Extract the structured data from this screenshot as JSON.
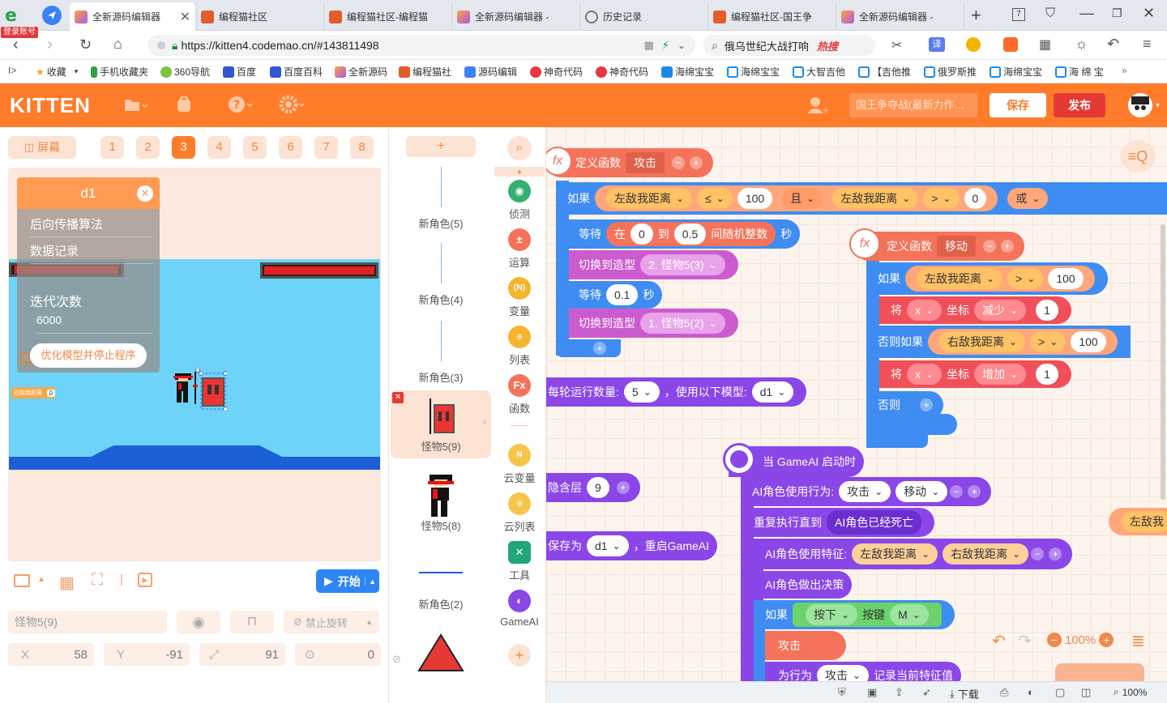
{
  "browser": {
    "login_badge": "登录账号",
    "tabs": [
      {
        "label": "全新源码编辑器",
        "active": true
      },
      {
        "label": "编程猫社区"
      },
      {
        "label": "编程猫社区-编程猫"
      },
      {
        "label": "全新源码编辑器 -"
      },
      {
        "label": "历史记录"
      },
      {
        "label": "编程猫社区-国王争"
      },
      {
        "label": "全新源码编辑器 -"
      }
    ],
    "url": "https://kitten4.codemao.cn/#143811498",
    "search_text": "俄乌世纪大战打响",
    "search_hot": "热搜",
    "translate_label": "译",
    "bookmarks": [
      "收藏",
      "手机收藏夹",
      "360导航",
      "百度",
      "百度百科",
      "全新源码",
      "编程猫社",
      "源码编辑",
      "神奇代码",
      "神奇代码",
      "海绵宝宝",
      "海绵宝宝",
      "大智吉他",
      "【吉他推",
      "俄罗斯推",
      "海绵宝宝",
      "海 绵 宝"
    ]
  },
  "kitten": {
    "logo": "KITTEN",
    "project_name": "国王争夺战(最新力作…",
    "save": "保存",
    "publish": "发布",
    "screen_btn": "屏幕",
    "scenes": [
      "1",
      "2",
      "3",
      "4",
      "5",
      "6",
      "7",
      "8"
    ],
    "active_scene": "3"
  },
  "stage": {
    "panel_title": "d1",
    "panel_items": [
      "后向传播算法",
      "数据记录"
    ],
    "iteration_label": "迭代次数",
    "iteration_value": "6000",
    "optimize_btn": "优化模型并停止程序",
    "small_label1": "左敌",
    "small_label2": "右敌我距离",
    "small_value2": "0",
    "start_btn": "开始"
  },
  "props": {
    "sprite_name": "怪物5(9)",
    "no_rotate": "禁止旋转",
    "x_label": "X",
    "x": "58",
    "y_label": "Y",
    "y": "-91",
    "size": "91",
    "dir": "0"
  },
  "sprites": [
    "新角色(5)",
    "新角色(4)",
    "新角色(3)",
    "怪物5(9)",
    "怪物5(8)",
    "新角色(2)"
  ],
  "categories": [
    "侦测",
    "运算",
    "变量",
    "列表",
    "函数",
    "云变量",
    "云列表",
    "工具",
    "GameAI"
  ],
  "blocks": {
    "def1": {
      "label": "定义函数",
      "name": "攻击"
    },
    "if1": {
      "if": "如果",
      "a": "左敌我距离",
      "op1": "≤",
      "v1": "100",
      "and": "且",
      "b": "左敌我距离",
      "op2": ">",
      "v2": "0",
      "or": "或"
    },
    "wait1": {
      "wait": "等待",
      "in": "在",
      "from": "0",
      "to": "到",
      "to_v": "0.5",
      "rand": "间随机整数",
      "sec": "秒"
    },
    "switch1": {
      "label": "切换到造型",
      "idx": "2.",
      "costume": "怪物5(3)"
    },
    "wait2": {
      "wait": "等待",
      "val": "0.1",
      "sec": "秒"
    },
    "switch2": {
      "label": "切换到造型",
      "idx": "1.",
      "costume": "怪物5(2)"
    },
    "perround": {
      "label": "每轮运行数量:",
      "val": "5",
      "mid": "，使用以下模型:",
      "model": "d1"
    },
    "hidden": {
      "label": "隐含层",
      "val": "9"
    },
    "saveas": {
      "label": "保存为",
      "model": "d1",
      "rest": "，重启GameAI"
    },
    "def2": {
      "label": "定义函数",
      "name": "移动"
    },
    "if2": {
      "if": "如果",
      "a": "左敌我距离",
      "op": ">",
      "v": "100"
    },
    "move1": {
      "set": "将",
      "axis": "x",
      "coord": "坐标",
      "dir": "减少",
      "v": "1"
    },
    "elif": {
      "label": "否则如果",
      "a": "右敌我距离",
      "op": ">",
      "v": "100"
    },
    "move2": {
      "set": "将",
      "axis": "x",
      "coord": "坐标",
      "dir": "增加",
      "v": "1"
    },
    "else": "否则",
    "gameai_start": "当 GameAI 启动时",
    "ai_behav": {
      "label": "AI角色使用行为:",
      "a": "攻击",
      "b": "移动"
    },
    "repeat": {
      "label": "重复执行直到",
      "cond": "AI角色已经死亡"
    },
    "feature": {
      "label": "AI角色使用特征:",
      "a": "左敌我距离",
      "b": "右敌我距离"
    },
    "decide": "AI角色做出决策",
    "if3": {
      "if": "如果",
      "press": "按下",
      "key": "按键",
      "k": "M"
    },
    "attack": "攻击",
    "record": {
      "pre": "为行为",
      "a": "攻击",
      "rest": "记录当前特征值"
    },
    "edge_pill": "左敌我"
  },
  "zoom": "100%",
  "status": {
    "download": "下载",
    "zoom": "100%"
  },
  "colors": {
    "orange": "#ff7c2b",
    "purple": "#8b46e8",
    "red": "#f0505a",
    "blue": "#3f8cf2",
    "salmon": "#f4735a",
    "sky": "#6dd3f8"
  }
}
